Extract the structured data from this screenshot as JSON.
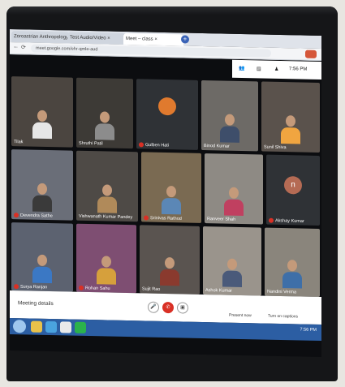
{
  "browser": {
    "tabs": [
      {
        "label": "Zoroastrian Anthropology ×"
      },
      {
        "label": "Test Audio/Video ×"
      },
      {
        "label": "Meet – class ×"
      }
    ],
    "url": "meet.google.com/ehr-qmle-aud"
  },
  "meet": {
    "time": "7:56 PM"
  },
  "participants": [
    {
      "name": "Tilak"
    },
    {
      "name": "Shruthi Patil"
    },
    {
      "name": "Gulben Hati"
    },
    {
      "name": "Binod Kumar"
    },
    {
      "name": "Sunil Shiva"
    },
    {
      "name": "Devendra Sathe"
    },
    {
      "name": "Vishwanath Kumar Pandey"
    },
    {
      "name": "Srinivas Rathod"
    },
    {
      "name": "Ranveer Shah"
    },
    {
      "name": "Akshay Kumar"
    },
    {
      "name": "Surya Ranjan"
    },
    {
      "name": "Rohan Sahu"
    },
    {
      "name": "Sujit Rao"
    },
    {
      "name": "Ashok Kumar"
    },
    {
      "name": "Nandini Verma"
    }
  ],
  "bottom_bar": {
    "meeting_label": "Meeting details",
    "present_label": "Present now",
    "captions_label": "Turn on captions"
  },
  "taskbar": {
    "clock": "7:56 PM"
  },
  "colors": {
    "tile_bg": "#2f3236",
    "taskbar": "#2c5ea3",
    "mic_muted": "#d93025"
  }
}
